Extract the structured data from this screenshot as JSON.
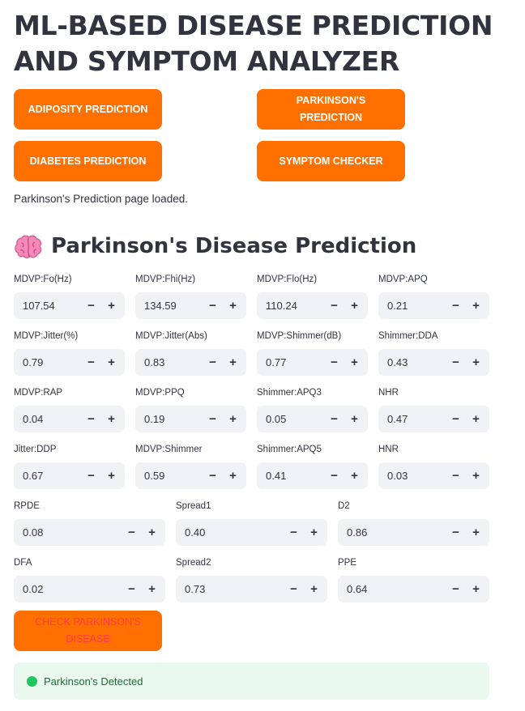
{
  "app": {
    "title": "ML-BASED DISEASE PREDICTION AND SYMPTOM ANALYZER"
  },
  "nav": {
    "adiposity": "ADIPOSITY PREDICTION",
    "parkinsons": "PARKINSON'S PREDICTION",
    "diabetes": "DIABETES PREDICTION",
    "symptom": "SYMPTOM CHECKER"
  },
  "status": {
    "message": "Parkinson's Prediction page loaded."
  },
  "section": {
    "heading": "Parkinson's Disease Prediction",
    "icon": "brain-icon"
  },
  "fields": {
    "fo": {
      "label": "MDVP:Fo(Hz)",
      "value": "107.54"
    },
    "fhi": {
      "label": "MDVP:Fhi(Hz)",
      "value": "134.59"
    },
    "flo": {
      "label": "MDVP:Flo(Hz)",
      "value": "110.24"
    },
    "apq": {
      "label": "MDVP:APQ",
      "value": "0.21"
    },
    "jitter_pct": {
      "label": "MDVP:Jitter(%)",
      "value": "0.79"
    },
    "jitter_abs": {
      "label": "MDVP:Jitter(Abs)",
      "value": "0.83"
    },
    "shimmer_db": {
      "label": "MDVP:Shimmer(dB)",
      "value": "0.77"
    },
    "shimmer_dda": {
      "label": "Shimmer:DDA",
      "value": "0.43"
    },
    "rap": {
      "label": "MDVP:RAP",
      "value": "0.04"
    },
    "ppq": {
      "label": "MDVP:PPQ",
      "value": "0.19"
    },
    "apq3": {
      "label": "Shimmer:APQ3",
      "value": "0.05"
    },
    "nhr": {
      "label": "NHR",
      "value": "0.47"
    },
    "ddp": {
      "label": "Jitter:DDP",
      "value": "0.67"
    },
    "shimmer": {
      "label": "MDVP:Shimmer",
      "value": "0.59"
    },
    "apq5": {
      "label": "Shimmer:APQ5",
      "value": "0.41"
    },
    "hnr": {
      "label": "HNR",
      "value": "0.03"
    },
    "rpde": {
      "label": "RPDE",
      "value": "0.08"
    },
    "spread1": {
      "label": "Spread1",
      "value": "0.40"
    },
    "d2": {
      "label": "D2",
      "value": "0.86"
    },
    "dfa": {
      "label": "DFA",
      "value": "0.02"
    },
    "spread2": {
      "label": "Spread2",
      "value": "0.73"
    },
    "ppe": {
      "label": "PPE",
      "value": "0.64"
    }
  },
  "stepper": {
    "minus": "−",
    "plus": "+"
  },
  "actions": {
    "check": "CHECK PARKINSON'S DISEASE"
  },
  "result": {
    "message": "Parkinson's Detected",
    "color": "#21c55d"
  },
  "colors": {
    "accent": "#ff7000",
    "input_bg": "#f0f2f6",
    "success_bg": "#e9f9ee"
  }
}
